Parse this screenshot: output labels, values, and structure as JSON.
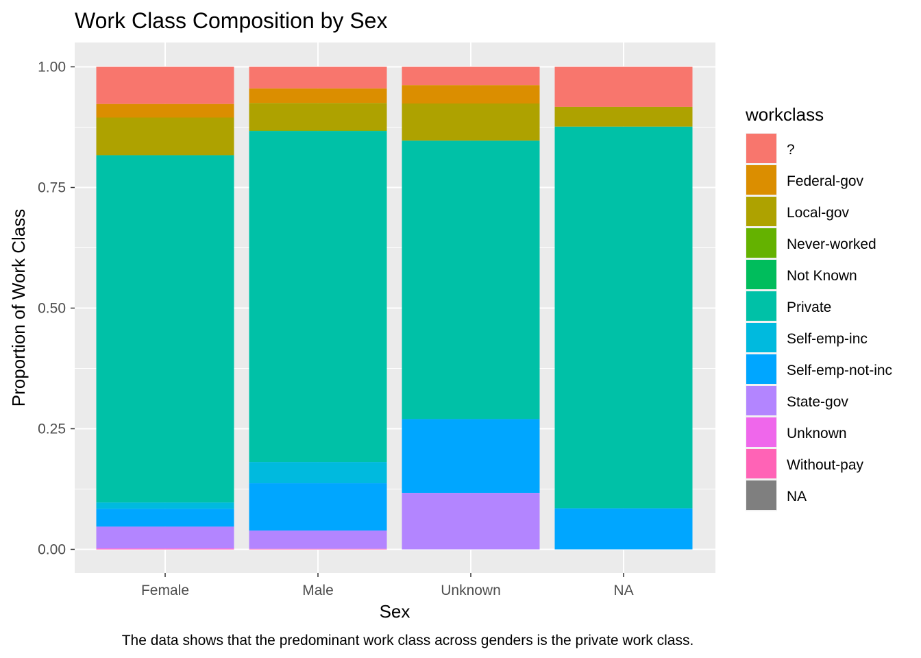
{
  "chart_data": {
    "type": "bar",
    "stacked": true,
    "title": "Work Class Composition by Sex",
    "xlabel": "Sex",
    "ylabel": "Proportion of Work Class",
    "caption": "The data shows that the predominant work class across genders is the private work class.",
    "ylim": [
      0,
      1
    ],
    "yticks": [
      "0.00",
      "0.25",
      "0.50",
      "0.75",
      "1.00"
    ],
    "ytick_values": [
      0,
      0.25,
      0.5,
      0.75,
      1.0
    ],
    "grid": true,
    "categories": [
      "Female",
      "Male",
      "Unknown",
      "NA"
    ],
    "legend": {
      "title": "workclass",
      "position": "right"
    },
    "series": [
      {
        "name": "?",
        "color": "#F8766D",
        "values": [
          0.077,
          0.045,
          0.038,
          0.083
        ]
      },
      {
        "name": "Federal-gov",
        "color": "#DB8E00",
        "values": [
          0.028,
          0.03,
          0.038,
          0.0
        ]
      },
      {
        "name": "Local-gov",
        "color": "#AEA200",
        "values": [
          0.078,
          0.057,
          0.077,
          0.041
        ]
      },
      {
        "name": "Never-worked",
        "color": "#64B200",
        "values": [
          0.0,
          0.001,
          0.0,
          0.0
        ]
      },
      {
        "name": "Not Known",
        "color": "#00BD5C",
        "values": [
          0.0,
          0.0,
          0.0,
          0.0
        ]
      },
      {
        "name": "Private",
        "color": "#00C1A7",
        "values": [
          0.719,
          0.686,
          0.577,
          0.791
        ]
      },
      {
        "name": "Self-emp-inc",
        "color": "#00BADE",
        "values": [
          0.013,
          0.044,
          0.0,
          0.0
        ]
      },
      {
        "name": "Self-emp-not-inc",
        "color": "#00A6FF",
        "values": [
          0.037,
          0.098,
          0.153,
          0.085
        ]
      },
      {
        "name": "State-gov",
        "color": "#B385FF",
        "values": [
          0.045,
          0.038,
          0.117,
          0.0
        ]
      },
      {
        "name": "Unknown",
        "color": "#EF67EB",
        "values": [
          0.001,
          0.0,
          0.0,
          0.0
        ]
      },
      {
        "name": "Without-pay",
        "color": "#FF63B6",
        "values": [
          0.001,
          0.001,
          0.0,
          0.0
        ]
      },
      {
        "name": "NA",
        "color": "#7F7F7F",
        "values": [
          0.0,
          0.0,
          0.0,
          0.0
        ]
      }
    ]
  }
}
